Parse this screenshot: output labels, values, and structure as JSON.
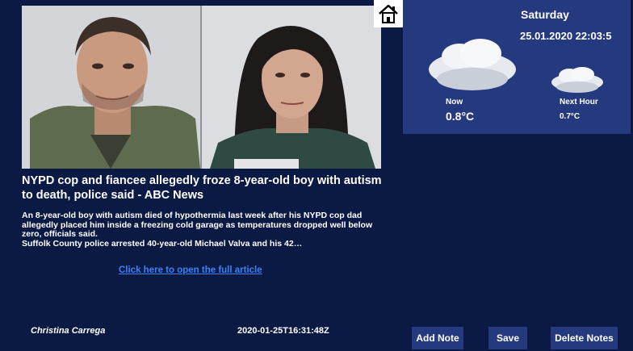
{
  "article": {
    "headline": "NYPD cop and fiancee allegedly froze 8-year-old boy with autism to death, police said - ABC News",
    "summary_line1": "An 8-year-old boy with autism died of hypothermia last week after his NYPD cop dad allegedly placed him inside a freezing cold garage as temperatures dropped well below zero, officials said.",
    "summary_line2": "Suffolk County police arrested 40-year-old Michael Valva and his 42…",
    "link_text": "Click here to open the full article",
    "author": "Christina Carrega",
    "published": "2020-01-25T16:31:48Z"
  },
  "weather": {
    "day": "Saturday",
    "datetime": "25.01.2020 22:03:5",
    "now_label": "Now",
    "now_temp": "0.8°C",
    "next_label": "Next Hour",
    "next_temp": "0.7°C",
    "now_icon": "cloud-icon",
    "next_icon": "cloud-icon"
  },
  "toolbar": {
    "add_note": "Add Note",
    "save": "Save",
    "delete_notes": "Delete Notes"
  },
  "colors": {
    "background": "#0b1a45",
    "panel": "#25397f",
    "link": "#3b82f6"
  }
}
